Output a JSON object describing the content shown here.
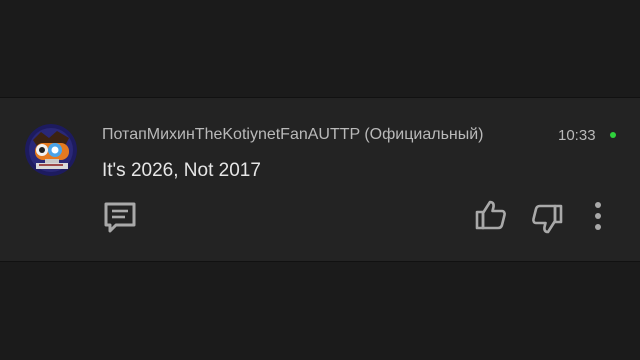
{
  "comment": {
    "author": "ПотапМихинTheKotiynetFanAUTTP (Официальный)",
    "time": "10:33",
    "text": "It's 2026, Not 2017",
    "status_color": "#2fd13c"
  },
  "icons": {
    "avatar": "avatar-cartoon",
    "reply": "reply-icon",
    "like": "thumbs-up-icon",
    "dislike": "thumbs-down-icon",
    "more": "more-vertical-icon"
  }
}
